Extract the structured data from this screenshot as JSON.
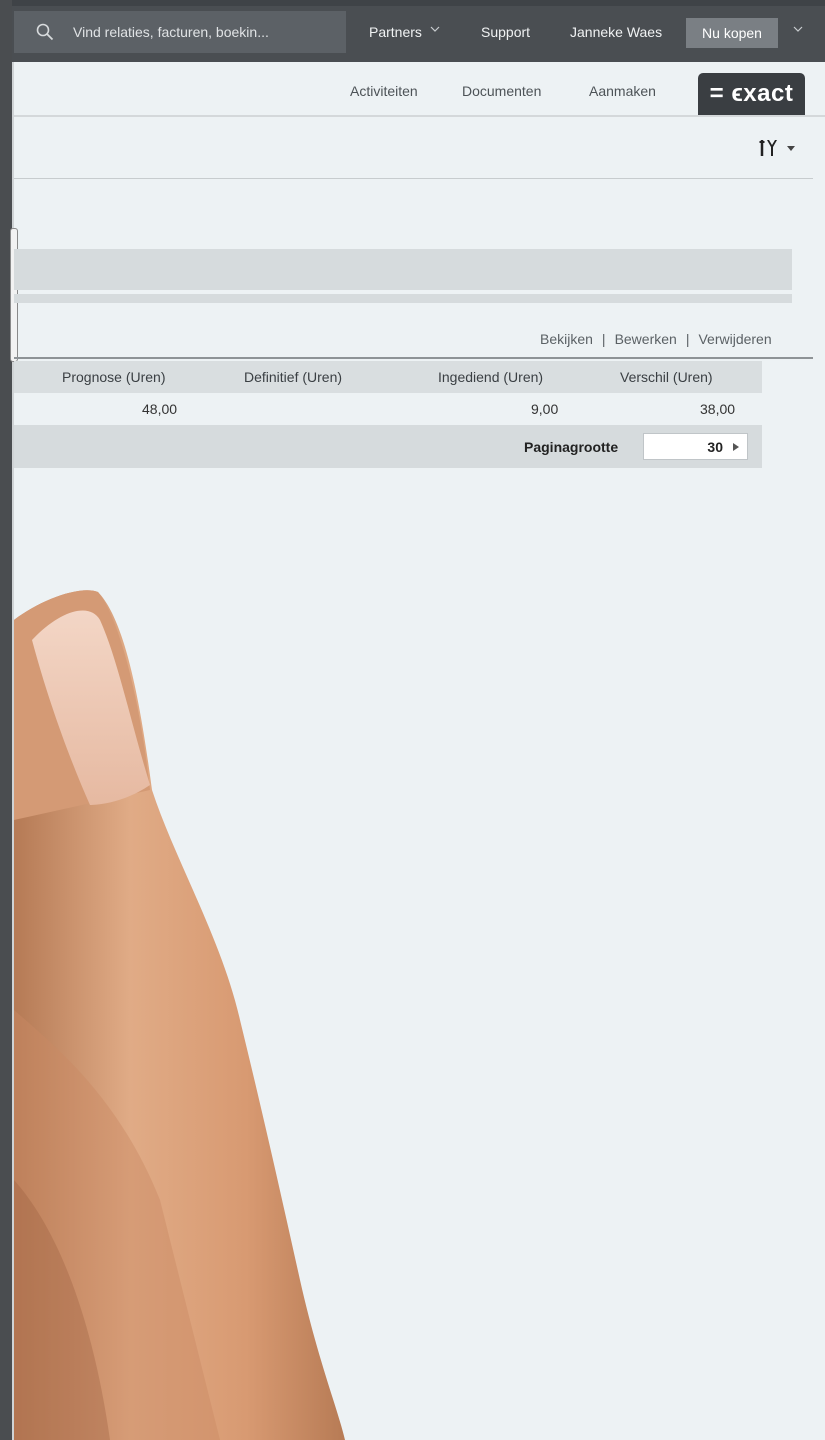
{
  "topbar": {
    "search_placeholder": "Vind relaties, facturen, boekin...",
    "partners": "Partners",
    "support": "Support",
    "user_name": "Janneke Waes",
    "buy_button": "Nu kopen"
  },
  "subnav": {
    "activities": "Activiteiten",
    "documents": "Documenten",
    "create": "Aanmaken",
    "logo": "= ϵxact"
  },
  "actions": {
    "view": "Bekijken",
    "edit": "Bewerken",
    "delete": "Verwijderen",
    "separator": "|"
  },
  "table": {
    "headers": [
      "Prognose (Uren)",
      "Definitief (Uren)",
      "Ingediend (Uren)",
      "Verschil (Uren)"
    ],
    "rows": [
      [
        "48,00",
        "",
        "9,00",
        "38,00"
      ]
    ]
  },
  "pagination": {
    "label": "Paginagrootte",
    "page_size": "30"
  },
  "icons": {
    "search": "search-icon",
    "chevron": "chevron-down-icon",
    "tools": "tools-icon",
    "play": "play-arrow-icon"
  },
  "colors": {
    "topbar": "#4a4e52",
    "background": "#edf2f4",
    "logo_bg": "#3a3e42",
    "header_grey": "#d6dbdd"
  }
}
